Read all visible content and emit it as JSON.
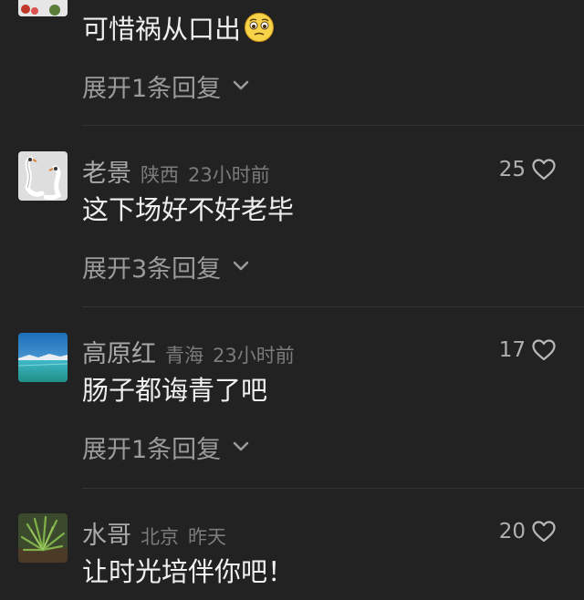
{
  "top_comment": {
    "text": "可惜祸从口出",
    "emoji": "woozy-face-emoji",
    "expand_label": "展开1条回复"
  },
  "comments": [
    {
      "username": "老景",
      "location": "陕西",
      "time": "23小时前",
      "likes": "25",
      "text": "这下场好不好老毕",
      "expand_label": "展开3条回复",
      "avatar": "swans-avatar"
    },
    {
      "username": "高原红",
      "location": "青海",
      "time": "23小时前",
      "likes": "17",
      "text": "肠子都诲青了吧",
      "expand_label": "展开1条回复",
      "avatar": "lake-avatar"
    },
    {
      "username": "水哥",
      "location": "北京",
      "time": "昨天",
      "likes": "20",
      "text": "让时光培伴你吧！",
      "avatar": "plant-avatar"
    }
  ],
  "icons": {
    "like": "heart-outline-icon",
    "expand": "chevron-down-icon"
  },
  "colors": {
    "background": "#222222",
    "username": "#a9a9a9",
    "meta": "#7b7b7b",
    "body": "#f0f0f0"
  }
}
